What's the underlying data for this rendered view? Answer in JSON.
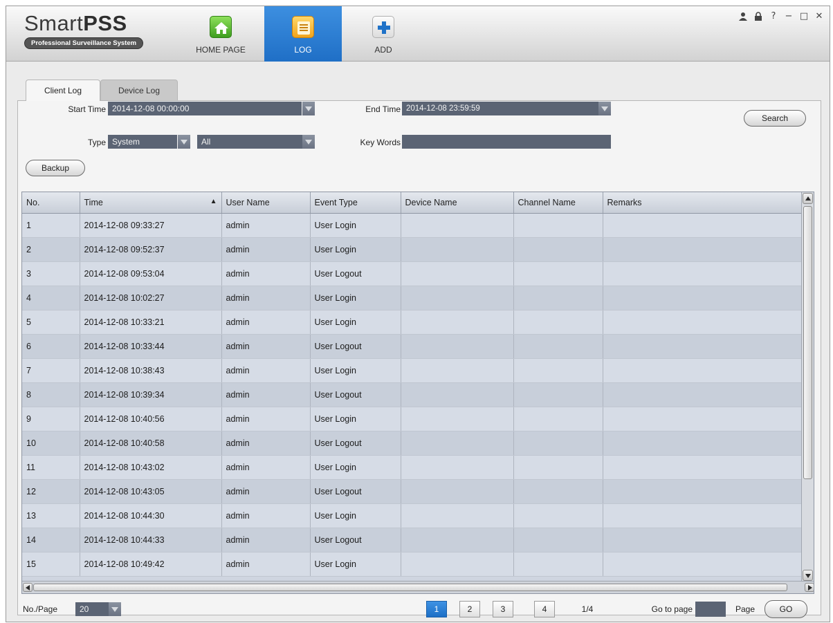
{
  "app": {
    "name_light": "Smart",
    "name_bold": "PSS",
    "tagline": "Professional Surveillance System"
  },
  "nav": {
    "home": "HOME PAGE",
    "log": "LOG",
    "add": "ADD",
    "active": "log"
  },
  "window_controls": [
    "user-icon",
    "lock-icon",
    "help-icon",
    "minimize-icon",
    "maximize-icon",
    "close-icon"
  ],
  "tabs": [
    {
      "label": "Client Log",
      "active": true
    },
    {
      "label": "Device Log",
      "active": false
    }
  ],
  "filters": {
    "start_time_label": "Start Time",
    "start_time_value": "2014-12-08 00:00:00",
    "end_time_label": "End Time",
    "end_time_value": "2014-12-08 23:59:59",
    "type_label": "Type",
    "type_value": "System",
    "subtype_value": "All",
    "keywords_label": "Key Words",
    "keywords_value": ""
  },
  "buttons": {
    "search": "Search",
    "backup": "Backup",
    "go": "GO"
  },
  "table": {
    "columns": [
      "No.",
      "Time",
      "User Name",
      "Event Type",
      "Device Name",
      "Channel Name",
      "Remarks"
    ],
    "sort_column": "Time",
    "sort_direction": "ascending",
    "rows": [
      [
        "1",
        "2014-12-08 09:33:27",
        "admin",
        "User Login",
        "",
        "",
        ""
      ],
      [
        "2",
        "2014-12-08 09:52:37",
        "admin",
        "User Login",
        "",
        "",
        ""
      ],
      [
        "3",
        "2014-12-08 09:53:04",
        "admin",
        "User Logout",
        "",
        "",
        ""
      ],
      [
        "4",
        "2014-12-08 10:02:27",
        "admin",
        "User Login",
        "",
        "",
        ""
      ],
      [
        "5",
        "2014-12-08 10:33:21",
        "admin",
        "User Login",
        "",
        "",
        ""
      ],
      [
        "6",
        "2014-12-08 10:33:44",
        "admin",
        "User Logout",
        "",
        "",
        ""
      ],
      [
        "7",
        "2014-12-08 10:38:43",
        "admin",
        "User Login",
        "",
        "",
        ""
      ],
      [
        "8",
        "2014-12-08 10:39:34",
        "admin",
        "User Logout",
        "",
        "",
        ""
      ],
      [
        "9",
        "2014-12-08 10:40:56",
        "admin",
        "User Login",
        "",
        "",
        ""
      ],
      [
        "10",
        "2014-12-08 10:40:58",
        "admin",
        "User Logout",
        "",
        "",
        ""
      ],
      [
        "11",
        "2014-12-08 10:43:02",
        "admin",
        "User Login",
        "",
        "",
        ""
      ],
      [
        "12",
        "2014-12-08 10:43:05",
        "admin",
        "User Logout",
        "",
        "",
        ""
      ],
      [
        "13",
        "2014-12-08 10:44:30",
        "admin",
        "User Login",
        "",
        "",
        ""
      ],
      [
        "14",
        "2014-12-08 10:44:33",
        "admin",
        "User Logout",
        "",
        "",
        ""
      ],
      [
        "15",
        "2014-12-08 10:49:42",
        "admin",
        "User Login",
        "",
        "",
        ""
      ]
    ]
  },
  "pagination": {
    "per_page_label": "No./Page",
    "per_page_value": "20",
    "pages": [
      "1",
      "2",
      "3",
      "4"
    ],
    "current_page": "1",
    "page_info": "1/4",
    "goto_label": "Go to page",
    "goto_value": "",
    "page_suffix": "Page"
  },
  "colors": {
    "accent": "#1f6fc6",
    "field_bg": "#5b6474",
    "row_light": "#d6dce6",
    "row_dark": "#c8cfda"
  }
}
